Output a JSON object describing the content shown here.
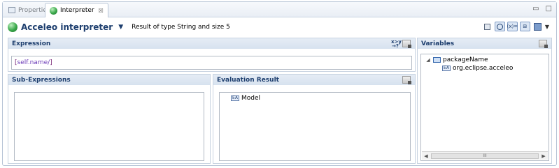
{
  "tabs": [
    {
      "label": "Properties",
      "icon": "properties-icon",
      "active": false
    },
    {
      "label": "Interpreter",
      "icon": "acceleo-icon",
      "active": true,
      "close": "☒"
    }
  ],
  "window_controls": {
    "minimize": "▭",
    "maximize": "□"
  },
  "header": {
    "title": "Acceleo interpreter",
    "result_text": "Result of type String and size 5"
  },
  "toolbar": {
    "buttons": [
      {
        "name": "save-icon",
        "active": false
      },
      {
        "name": "realtime-clock-icon",
        "active": true
      },
      {
        "name": "variables-icon",
        "active": true
      },
      {
        "name": "link-icon",
        "active": true
      },
      {
        "name": "export-icon",
        "active": false
      }
    ]
  },
  "expression": {
    "header": "Expression",
    "value_open": "[",
    "value_body": "self.name/",
    "value_close": "]"
  },
  "sub_expressions": {
    "header": "Sub-Expressions"
  },
  "evaluation_result": {
    "header": "Evaluation Result",
    "items": [
      {
        "label": "Model",
        "icon": "attribute-icon"
      }
    ]
  },
  "variables": {
    "header": "Variables",
    "tree": [
      {
        "label": "packageName",
        "icon": "package-icon",
        "expanded": true,
        "children": [
          {
            "label": "org.eclipse.acceleo",
            "icon": "attribute-icon"
          }
        ]
      }
    ],
    "scroll_thumb": "III"
  },
  "colors": {
    "section_title": "#1d3e6e",
    "border": "#c8d3e1",
    "header_gradient_top": "#e5ecf5",
    "header_gradient_bottom": "#d7e2ef"
  }
}
